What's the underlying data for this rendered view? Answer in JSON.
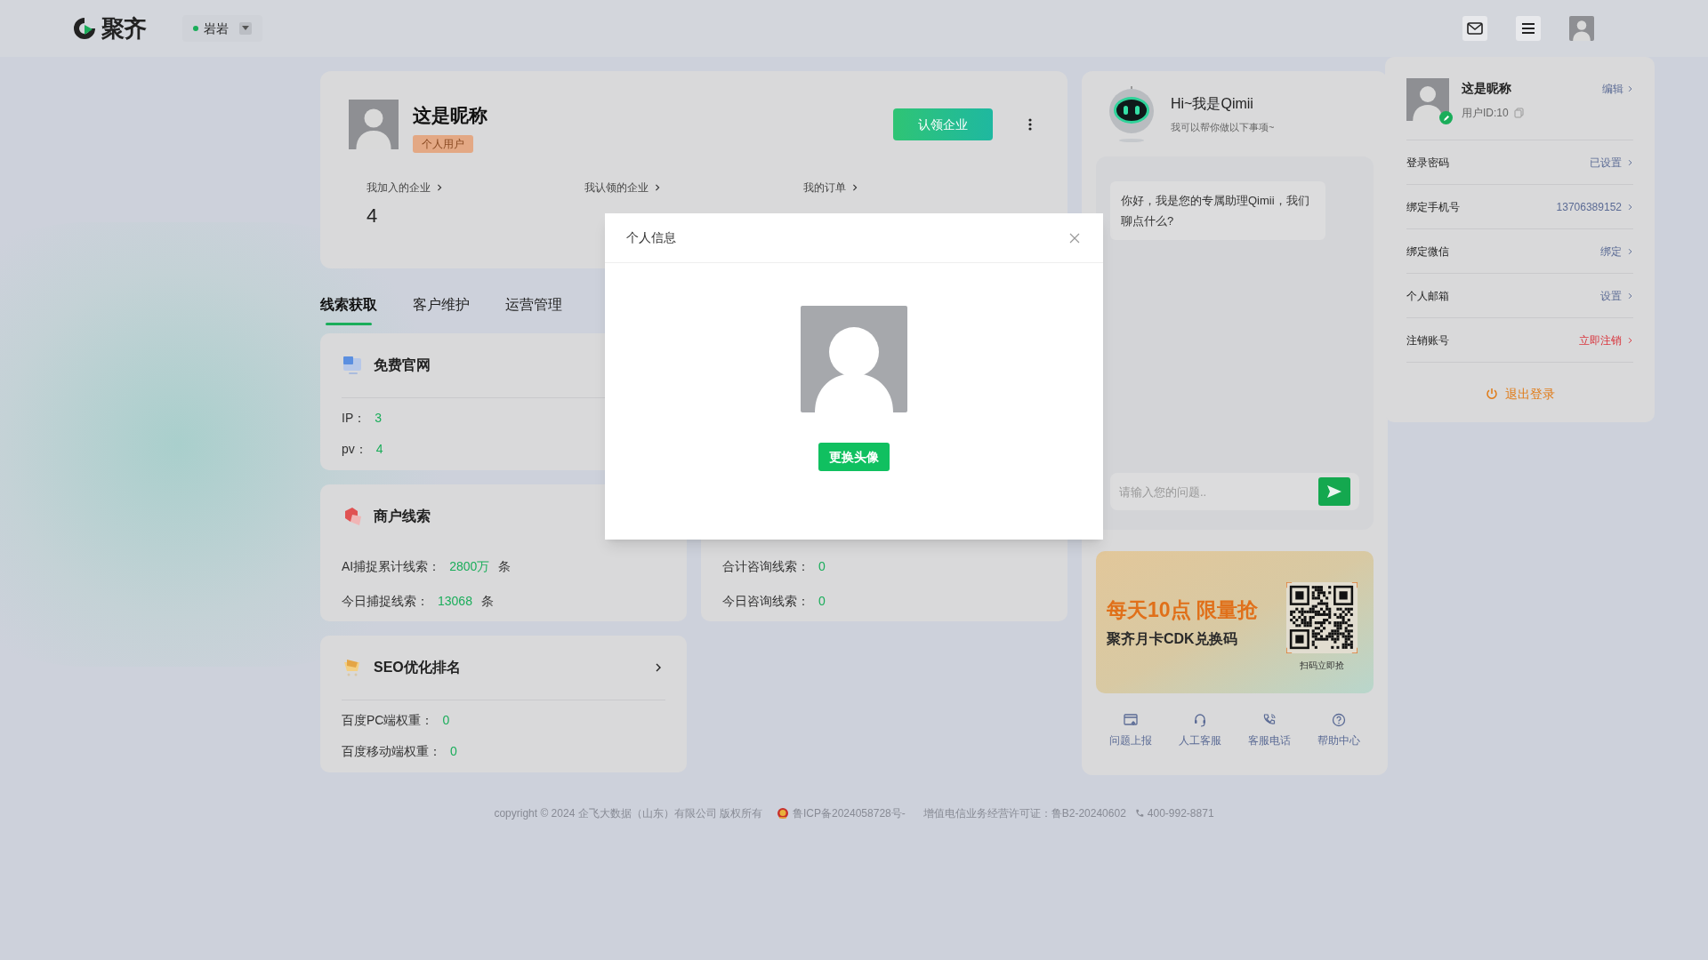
{
  "header": {
    "logo_text": "聚齐",
    "workspace": {
      "name": "岩岩",
      "online": true
    }
  },
  "profile": {
    "name": "这是昵称",
    "badge": "个人用户",
    "claim_button": "认领企业",
    "stats": [
      {
        "label": "我加入的企业",
        "value": "4"
      },
      {
        "label": "我认领的企业"
      },
      {
        "label": "我的订单"
      }
    ]
  },
  "tabs": [
    {
      "label": "线索获取",
      "selected": true
    },
    {
      "label": "客户维护",
      "selected": false
    },
    {
      "label": "运营管理",
      "selected": false
    }
  ],
  "cards": [
    {
      "title": "免费官网",
      "divider": true,
      "rows": [
        {
          "label": "IP：",
          "value": "3"
        },
        {
          "label": "pv：",
          "value": "4"
        }
      ]
    },
    {
      "title": "商户线索",
      "divider": false,
      "rows": [
        {
          "label": "AI捕捉累计线索：",
          "value": "2800万",
          "unit": "条"
        },
        {
          "label": "今日捕捉线索：",
          "value": "13068",
          "unit": "条"
        }
      ]
    },
    {
      "title": "SEO优化排名",
      "divider": true,
      "arrow": true,
      "rows": [
        {
          "label": "百度PC端权重：",
          "value": "0"
        },
        {
          "label": "百度移动端权重：",
          "value": "0"
        }
      ]
    }
  ],
  "consult_card": {
    "rows": [
      {
        "label": "合计咨询线索：",
        "value": "0"
      },
      {
        "label": "今日咨询线索：",
        "value": "0"
      }
    ]
  },
  "assistant": {
    "title": "Hi~我是Qimii",
    "subtitle": "我可以帮你做以下事项~",
    "messages": [
      "你好，我是您的专属助理Qimii，我们聊点什么?"
    ],
    "input": {
      "placeholder": "请输入您的问题.."
    },
    "banner": {
      "headline": "每天10点 限量抢",
      "subline": "聚齐月卡CDK兑换码",
      "qr_caption": "扫码立即抢"
    },
    "shortcuts": [
      {
        "label": "问题上报"
      },
      {
        "label": "人工客服"
      },
      {
        "label": "客服电话"
      },
      {
        "label": "帮助中心"
      }
    ]
  },
  "account_menu": {
    "name": "这是昵称",
    "edit": "编辑",
    "user_id": "用户ID:10",
    "rows": [
      {
        "label": "登录密码",
        "value": "已设置",
        "kind": "normal"
      },
      {
        "label": "绑定手机号",
        "value": "13706389152",
        "kind": "normal"
      },
      {
        "label": "绑定微信",
        "value": "绑定",
        "kind": "normal"
      },
      {
        "label": "个人邮箱",
        "value": "设置",
        "kind": "normal"
      },
      {
        "label": "注销账号",
        "value": "立即注销",
        "kind": "danger"
      }
    ],
    "logout": "退出登录"
  },
  "modal": {
    "title": "个人信息",
    "button": "更换头像"
  },
  "footer": {
    "copyright": "copyright © 2024 企飞大数据（山东）有限公司 版权所有",
    "icp": "鲁ICP备2024058728号-",
    "license": "增值电信业务经营许可证：鲁B2-20240602",
    "phone": "400-992-8871"
  }
}
